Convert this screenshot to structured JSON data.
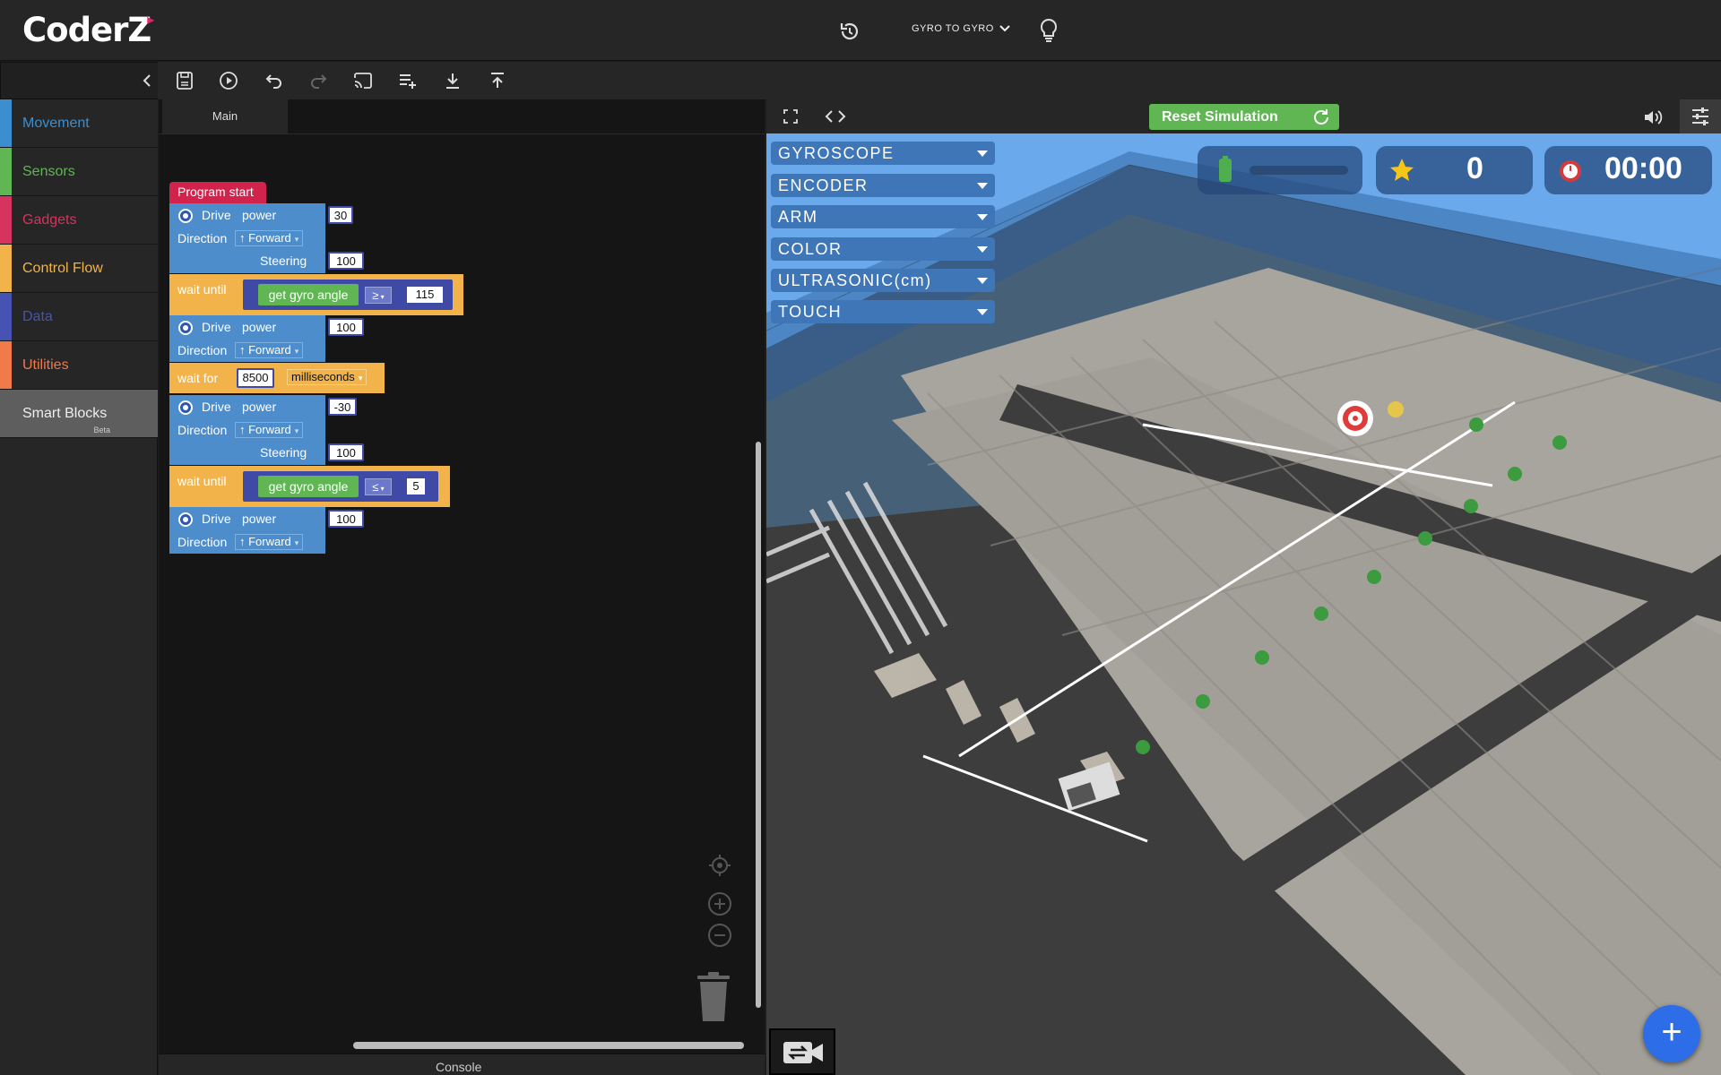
{
  "app": {
    "logo": "CoderZ"
  },
  "header": {
    "mission_title": "GYRO TO GYRO"
  },
  "categories": [
    {
      "label": "Movement",
      "color": "#3b8fd0"
    },
    {
      "label": "Sensors",
      "color": "#5fb653"
    },
    {
      "label": "Gadgets",
      "color": "#d6335f"
    },
    {
      "label": "Control Flow",
      "color": "#f2b34b"
    },
    {
      "label": "Data",
      "color": "#4753b3"
    },
    {
      "label": "Utilities",
      "color": "#f07a4a"
    },
    {
      "label": "Smart Blocks",
      "badge": "Beta"
    }
  ],
  "workspace": {
    "tab": "Main",
    "console_label": "Console",
    "program": {
      "start_label": "Program start",
      "drive_1": {
        "label": "Drive",
        "power_label": "power",
        "power": "30",
        "direction_label": "Direction",
        "direction": "↑ Forward",
        "steering_label": "Steering",
        "steering": "100"
      },
      "wait_1": {
        "label": "wait until",
        "sensor": "get gyro angle",
        "operator": "≥",
        "value": "115"
      },
      "drive_2": {
        "label": "Drive",
        "power_label": "power",
        "power": "100",
        "direction_label": "Direction",
        "direction": "↑ Forward"
      },
      "wait_2": {
        "label": "wait for",
        "value": "8500",
        "unit": "milliseconds"
      },
      "drive_3": {
        "label": "Drive",
        "power_label": "power",
        "power": "-30",
        "direction_label": "Direction",
        "direction": "↑ Forward",
        "steering_label": "Steering",
        "steering": "100"
      },
      "wait_3": {
        "label": "wait until",
        "sensor": "get gyro angle",
        "operator": "≤",
        "value": "5"
      },
      "drive_4": {
        "label": "Drive",
        "power_label": "power",
        "power": "100",
        "direction_label": "Direction",
        "direction": "↑ Forward"
      }
    }
  },
  "simulation": {
    "reset_label": "Reset Simulation",
    "sensors": [
      "GYROSCOPE",
      "ENCODER",
      "ARM",
      "COLOR",
      "ULTRASONIC(cm)",
      "TOUCH"
    ],
    "stars": "0",
    "timer": "00:00"
  },
  "colors": {
    "accent_green": "#5fb653",
    "block_blue": "#4d8dcb",
    "block_orange": "#f2b34b",
    "fab_blue": "#2d6ee8"
  }
}
